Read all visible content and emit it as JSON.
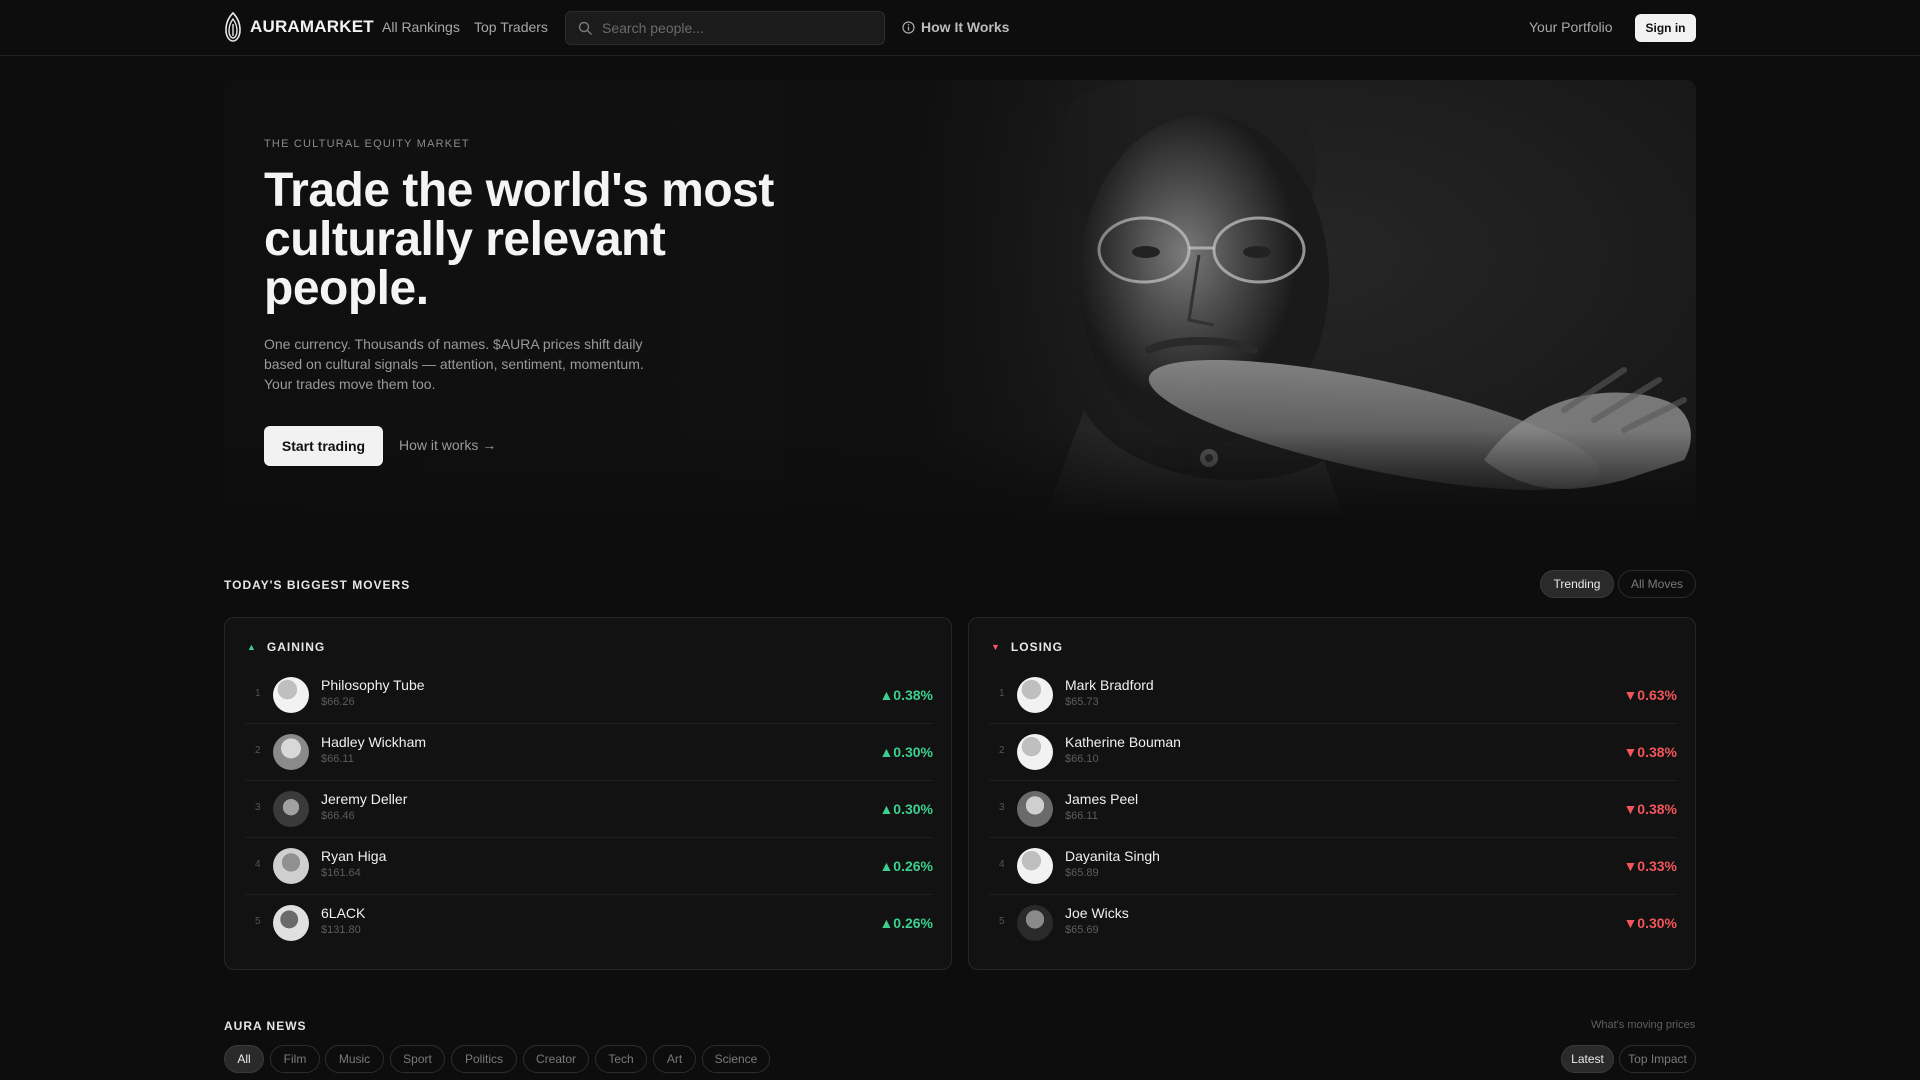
{
  "header": {
    "brand": "AURAMARKET",
    "nav": {
      "all_rankings": "All Rankings",
      "top_traders": "Top Traders"
    },
    "search_placeholder": "Search people...",
    "how_it_works": "How It Works",
    "portfolio": "Your Portfolio",
    "sign_in": "Sign in"
  },
  "hero": {
    "eyebrow": "THE CULTURAL EQUITY MARKET",
    "headline": "Trade the world's most culturally relevant people.",
    "subtext": "One currency. Thousands of names. $AURA prices shift daily based on cultural signals — attention, sentiment, momentum. Your trades move them too.",
    "cta_primary": "Start trading",
    "cta_secondary": "How it works →"
  },
  "movers": {
    "title": "TODAY'S BIGGEST MOVERS",
    "toggle": [
      "Trending",
      "All Moves"
    ],
    "gaining": {
      "label": "GAINING",
      "items": [
        {
          "rank": "1",
          "name": "Philosophy Tube",
          "price": "$66.26",
          "change": "▲0.38%"
        },
        {
          "rank": "2",
          "name": "Hadley Wickham",
          "price": "$66.11",
          "change": "▲0.30%"
        },
        {
          "rank": "3",
          "name": "Jeremy Deller",
          "price": "$66.46",
          "change": "▲0.30%"
        },
        {
          "rank": "4",
          "name": "Ryan Higa",
          "price": "$161.64",
          "change": "▲0.26%"
        },
        {
          "rank": "5",
          "name": "6LACK",
          "price": "$131.80",
          "change": "▲0.26%"
        }
      ]
    },
    "losing": {
      "label": "LOSING",
      "items": [
        {
          "rank": "1",
          "name": "Mark Bradford",
          "price": "$65.73",
          "change": "▼0.63%"
        },
        {
          "rank": "2",
          "name": "Katherine Bouman",
          "price": "$66.10",
          "change": "▼0.38%"
        },
        {
          "rank": "3",
          "name": "James Peel",
          "price": "$66.11",
          "change": "▼0.38%"
        },
        {
          "rank": "4",
          "name": "Dayanita Singh",
          "price": "$65.89",
          "change": "▼0.33%"
        },
        {
          "rank": "5",
          "name": "Joe Wicks",
          "price": "$65.69",
          "change": "▼0.30%"
        }
      ]
    }
  },
  "news": {
    "title": "AURA NEWS",
    "note": "What's moving prices",
    "categories": [
      "All",
      "Film",
      "Music",
      "Sport",
      "Politics",
      "Creator",
      "Tech",
      "Art",
      "Science"
    ],
    "sort": [
      "Latest",
      "Top Impact"
    ]
  },
  "colors": {
    "gain": "#3ccf8e",
    "loss": "#f2555a",
    "background": "#0d0d0d"
  }
}
